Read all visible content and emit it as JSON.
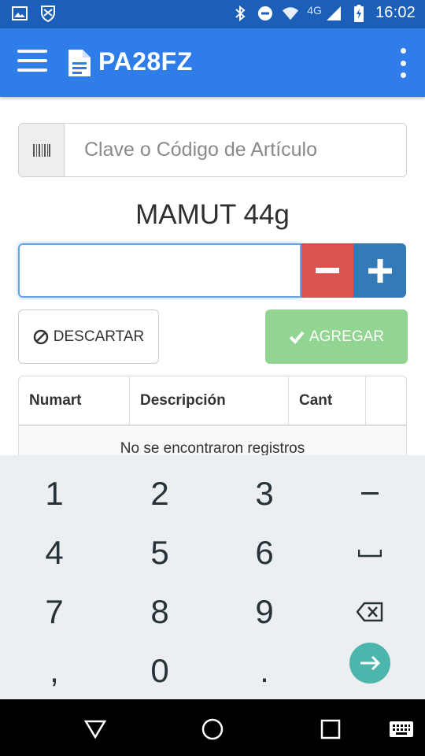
{
  "status_bar": {
    "time": "16:02",
    "network": "4G",
    "icons": [
      "image-icon",
      "shield-icon",
      "bluetooth-icon",
      "do-not-disturb-icon",
      "wifi-icon",
      "signal-icon",
      "battery-charging-icon"
    ]
  },
  "app_bar": {
    "title": "PA28FZ",
    "menu_icon": "hamburger-menu-icon",
    "doc_icon": "document-icon",
    "overflow_icon": "more-vertical-icon",
    "color": "#2f7de8"
  },
  "search": {
    "placeholder": "Clave o Código de Artículo",
    "value": "",
    "icon": "barcode-icon"
  },
  "product": {
    "name": "MAMUT 44g"
  },
  "quantity": {
    "value": "",
    "minus_color": "#d9534f",
    "plus_color": "#337ab7"
  },
  "buttons": {
    "discard": "DESCARTAR",
    "add": "AGREGAR"
  },
  "table": {
    "columns": [
      "Numart",
      "Descripción",
      "Cant",
      ""
    ],
    "empty_message": "No se encontraron registros"
  },
  "keyboard": {
    "rows": [
      [
        "1",
        "2",
        "3",
        "−"
      ],
      [
        "4",
        "5",
        "6",
        "␣"
      ],
      [
        "7",
        "8",
        "9",
        "⌫"
      ],
      [
        ",",
        "0",
        ".",
        "→"
      ]
    ]
  },
  "nav_bar": {
    "icons": [
      "back-triangle-icon",
      "home-circle-icon",
      "recents-square-icon",
      "keyboard-switch-icon"
    ]
  }
}
